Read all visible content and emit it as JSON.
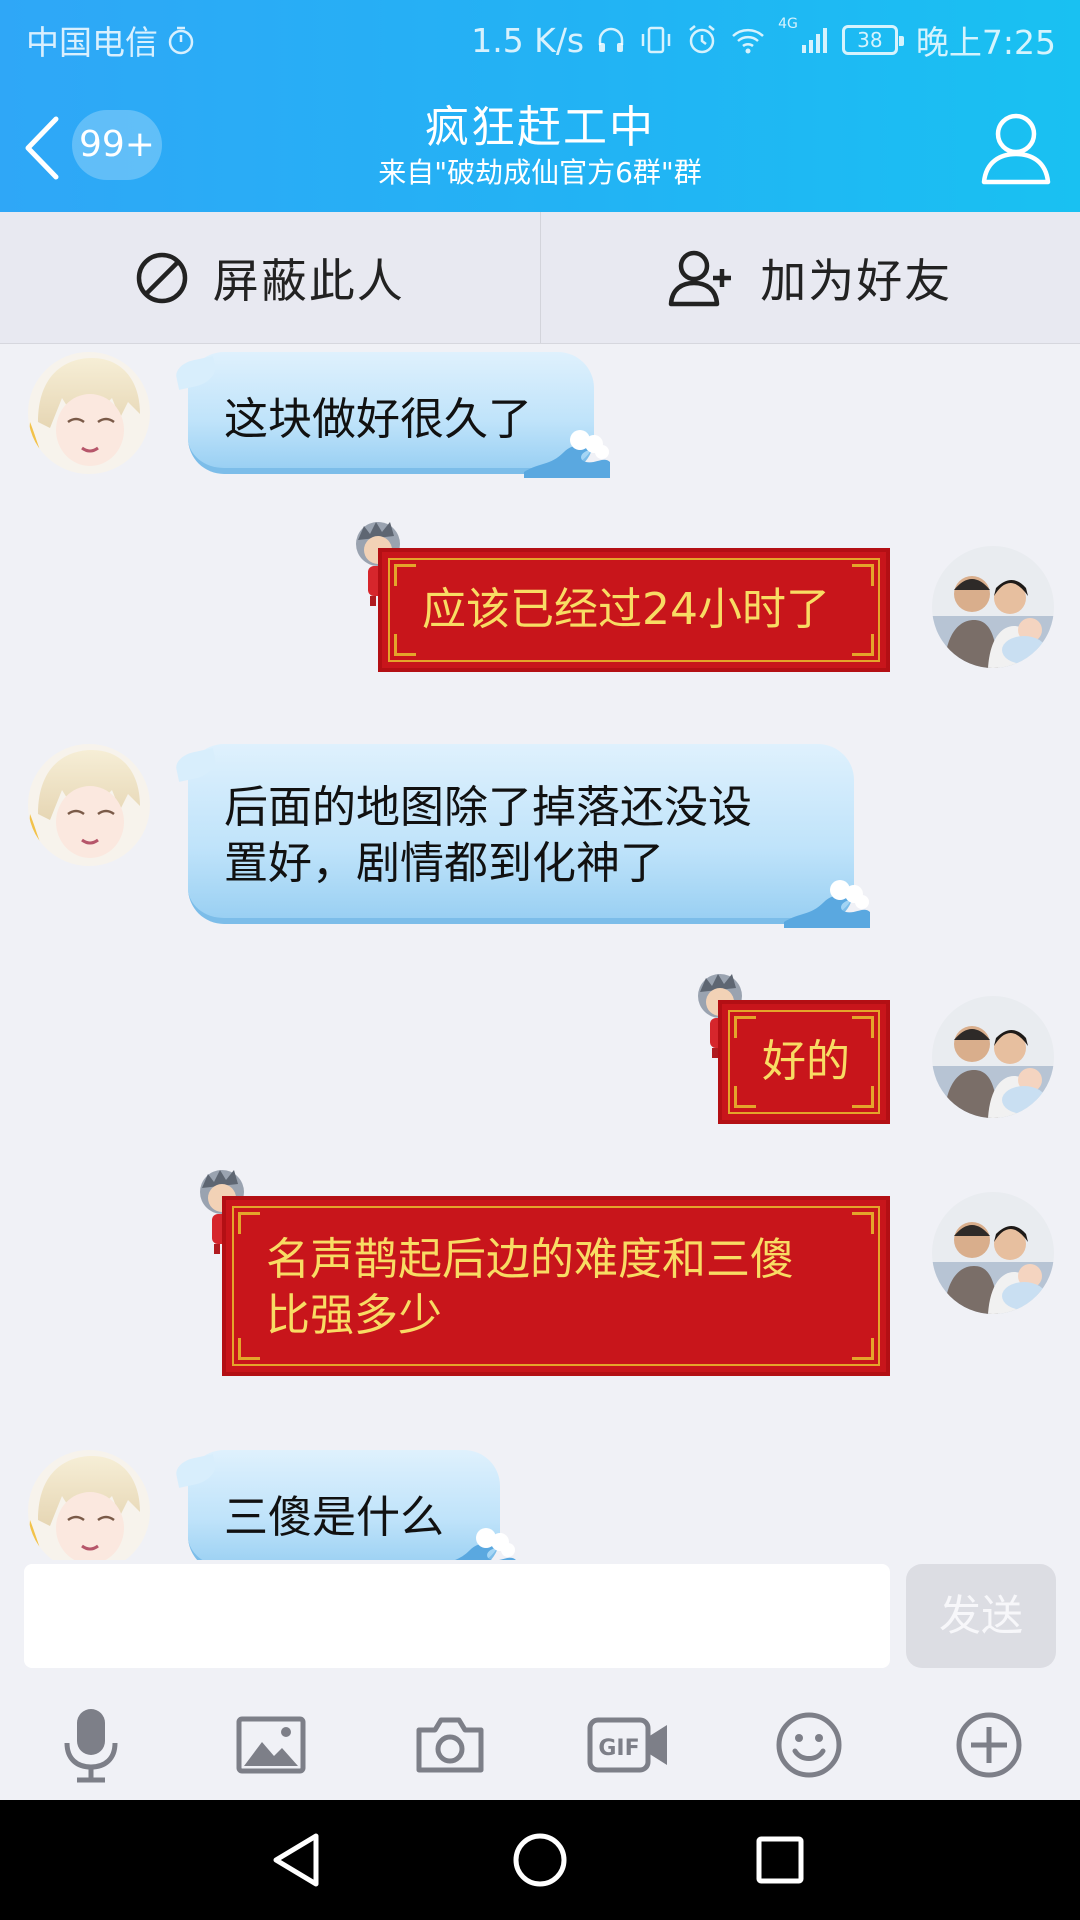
{
  "status_bar": {
    "carrier": "中国电信",
    "net_speed": "1.5 K/s",
    "network_type": "4G",
    "battery": "38",
    "time": "晚上7:25"
  },
  "header": {
    "unread_count": "99+",
    "title": "疯狂赶工中",
    "subtitle": "来自\"破劫成仙官方6群\"群"
  },
  "actions": {
    "block_label": "屏蔽此人",
    "add_friend_label": "加为好友"
  },
  "messages": [
    {
      "side": "left",
      "text": "这块做好很久了"
    },
    {
      "side": "right",
      "text": "应该已经过24小时了"
    },
    {
      "side": "left",
      "text_line1": "后面的地图除了掉落还没设",
      "text_line2": "置好，剧情都到化神了"
    },
    {
      "side": "right",
      "text": "好的"
    },
    {
      "side": "right",
      "text_line1": "名声鹊起后边的难度和三傻",
      "text_line2": "比强多少"
    },
    {
      "side": "left",
      "text": "三傻是什么"
    }
  ],
  "input": {
    "placeholder": "",
    "send_label": "发送"
  },
  "colors": {
    "header_start": "#2fa7f7",
    "header_end": "#19c1f2",
    "red_bubble": "#c8151b",
    "red_bubble_text": "#f8dc64",
    "blue_bubble": "#bfe3fa"
  },
  "toolbar_icons": [
    "mic-icon",
    "image-icon",
    "camera-icon",
    "gif-icon",
    "emoji-icon",
    "plus-icon"
  ]
}
